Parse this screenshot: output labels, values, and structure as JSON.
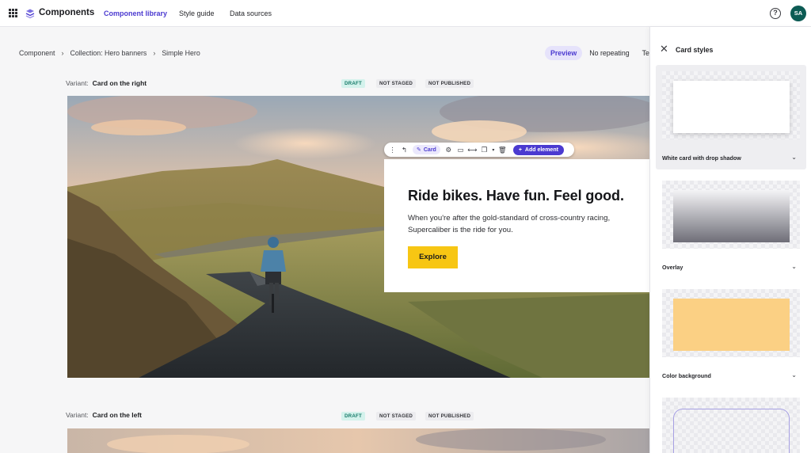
{
  "topbar": {
    "brand": "Components",
    "nav": [
      "Component library",
      "Style guide",
      "Data sources"
    ],
    "help_glyph": "?",
    "avatar_initials": "SA",
    "accent": "#4b3ad0"
  },
  "breadcrumb": [
    "Component",
    "Collection: Hero banners",
    "Simple Hero"
  ],
  "preview_tabs": [
    "Preview",
    "No repeating",
    "Ter"
  ],
  "variants": [
    {
      "prefix": "Variant:",
      "name": "Card on the right",
      "badges": [
        "DRAFT",
        "NOT STAGED",
        "NOT PUBLISHED"
      ]
    },
    {
      "prefix": "Variant:",
      "name": "Card on the left",
      "badges": [
        "DRAFT",
        "NOT STAGED",
        "NOT PUBLISHED"
      ]
    }
  ],
  "hero": {
    "title": "Ride bikes. Have fun. Feel good.",
    "body": "When you're after the gold-standard of cross-country racing, Supercaliber is the ride for you.",
    "cta": "Explore",
    "cta_color": "#f7c613"
  },
  "toolbar": {
    "card_label": "Card",
    "add_label": "Add element",
    "icons": [
      "drag-handle-icon",
      "select-parent-icon",
      "settings-icon",
      "layout-icon",
      "width-icon",
      "duplicate-icon",
      "trash-icon"
    ]
  },
  "panel": {
    "title": "Card styles",
    "styles": [
      "White card with drop shadow",
      "Overlay",
      "Color background"
    ]
  }
}
